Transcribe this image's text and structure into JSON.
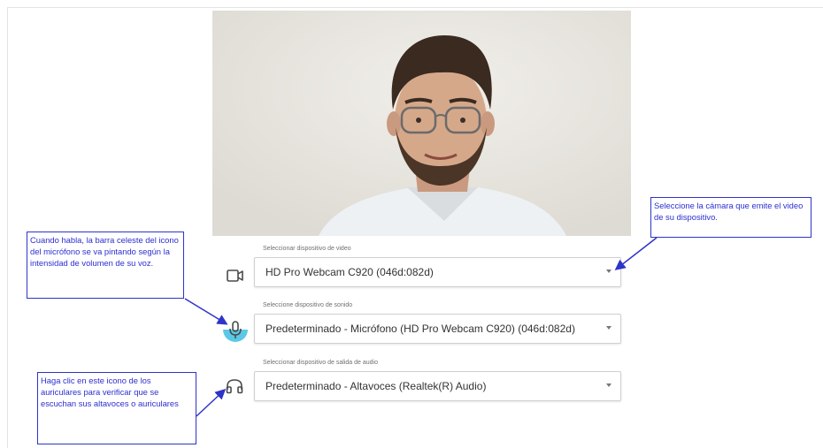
{
  "devices": {
    "video": {
      "label": "Seleccionar dispositivo de video",
      "value": "HD Pro Webcam C920 (046d:082d)",
      "icon": "camera-icon"
    },
    "audio_in": {
      "label": "Seleccione dispositivo de sonido",
      "value": "Predeterminado - Micrófono (HD Pro Webcam C920) (046d:082d)",
      "icon": "microphone-icon",
      "level": 0.5
    },
    "audio_out": {
      "label": "Seleccionar dispositivo de salida de audio",
      "value": "Predeterminado - Altavoces (Realtek(R) Audio)",
      "icon": "headphones-icon"
    }
  },
  "annotations": {
    "camera": "Seleccione la cámara que emite el video de su dispositivo.",
    "microphone": "Cuando habla, la barra celeste del icono del micrófono se va pintando según la intensidad de volumen de su voz.",
    "headphones": "Haga clic en este icono de los auriculares para verificar que se escuchan sus altavoces o auriculares"
  },
  "colors": {
    "annotation": "#2e34c8",
    "mic_level": "#5bc8e6"
  }
}
